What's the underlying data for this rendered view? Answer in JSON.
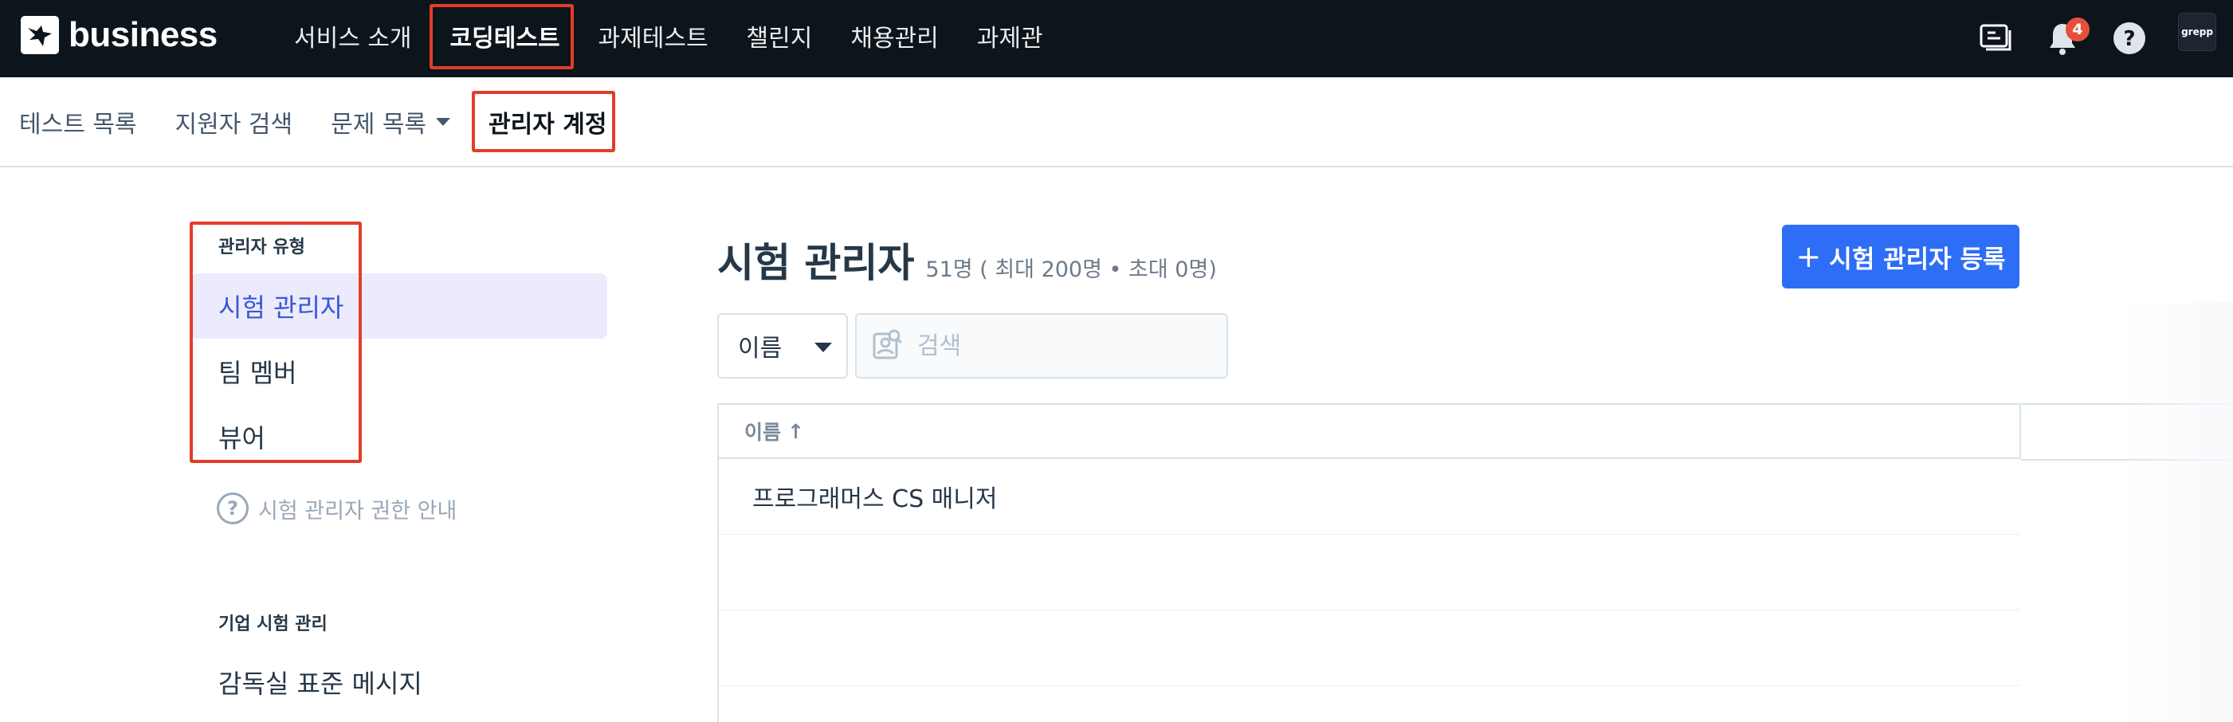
{
  "brand": {
    "name": "business"
  },
  "gnb": {
    "items": [
      {
        "label": "서비스 소개"
      },
      {
        "label": "코딩테스트"
      },
      {
        "label": "과제테스트"
      },
      {
        "label": "챌린지"
      },
      {
        "label": "채용관리"
      },
      {
        "label": "과제관"
      }
    ],
    "active_index": 1,
    "notification_count": "4",
    "avatar_text": "grepp"
  },
  "subnav": {
    "items": [
      {
        "label": "테스트 목록"
      },
      {
        "label": "지원자 검색"
      },
      {
        "label": "문제 목록"
      },
      {
        "label": "관리자 계정"
      }
    ],
    "active_index": 3
  },
  "sidebar": {
    "section1_title": "관리자 유형",
    "items": [
      {
        "label": "시험 관리자"
      },
      {
        "label": "팀 멤버"
      },
      {
        "label": "뷰어"
      }
    ],
    "active_index": 0,
    "help_label": "시험 관리자 권한 안내",
    "section2_title": "기업 시험 관리",
    "section2_items": [
      {
        "label": "감독실 표준 메시지"
      }
    ]
  },
  "main": {
    "title": "시험 관리자",
    "count_text": "51명 ( 최대 200명 • 초대 0명)",
    "register_button": "시험 관리자 등록",
    "filter_select": "이름",
    "search_placeholder": "검색",
    "table": {
      "header": "이름",
      "sort_icon": "↑",
      "rows": [
        {
          "name": "프로그래머스 CS 매니저"
        }
      ]
    }
  },
  "colors": {
    "topbar_bg": "#0c151c",
    "accent_blue": "#2e6df6",
    "active_side_bg": "#ebebfd",
    "active_side_text": "#3a57d3",
    "annotation_red": "#e23d29",
    "badge_red": "#e5503c"
  }
}
